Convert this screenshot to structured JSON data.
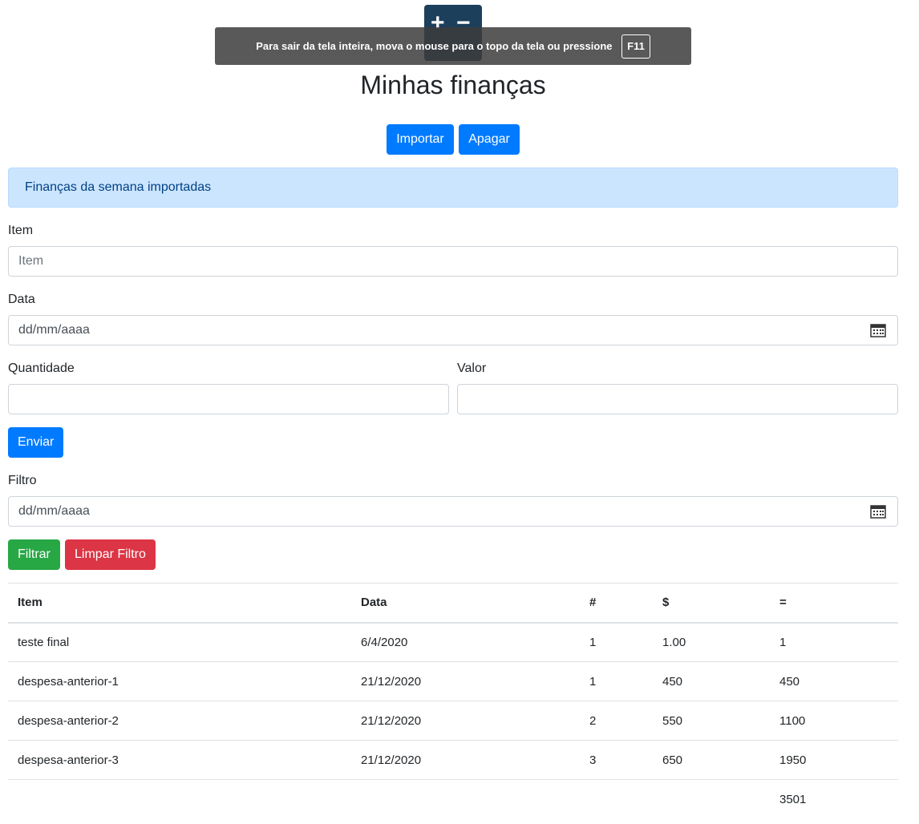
{
  "page": {
    "title": "Minhas finanças"
  },
  "toolbar": {
    "import_label": "Importar",
    "delete_label": "Apagar"
  },
  "alert": {
    "message": "Finanças da semana importadas"
  },
  "form": {
    "item_label": "Item",
    "item_placeholder": "Item",
    "date_label": "Data",
    "date_placeholder": "dd/mm/aaaa",
    "quantity_label": "Quantidade",
    "value_label": "Valor",
    "submit_label": "Enviar"
  },
  "filter": {
    "label": "Filtro",
    "date_placeholder": "dd/mm/aaaa",
    "apply_label": "Filtrar",
    "clear_label": "Limpar Filtro"
  },
  "table": {
    "headers": [
      "Item",
      "Data",
      "#",
      "$",
      "="
    ],
    "rows": [
      [
        "teste final",
        "6/4/2020",
        "1",
        "1.00",
        "1"
      ],
      [
        "despesa-anterior-1",
        "21/12/2020",
        "1",
        "450",
        "450"
      ],
      [
        "despesa-anterior-2",
        "21/12/2020",
        "2",
        "550",
        "1100"
      ],
      [
        "despesa-anterior-3",
        "21/12/2020",
        "3",
        "650",
        "1950"
      ]
    ],
    "total": "3501"
  },
  "fullscreen_notice": {
    "message": "Para sair da tela inteira, mova o mouse para o topo da tela ou pressione",
    "key": "F11"
  },
  "zoom": {
    "in_icon": "plus-icon",
    "out_icon": "minus-icon"
  }
}
